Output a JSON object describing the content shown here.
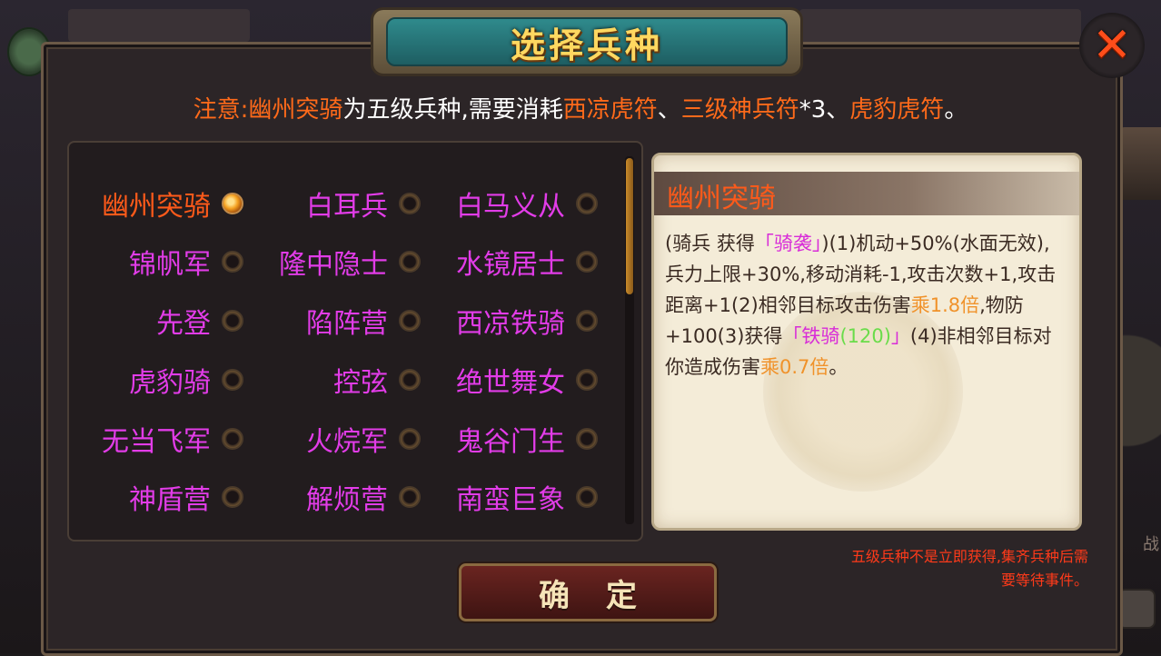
{
  "title": "选择兵种",
  "close_icon": "close-x-icon",
  "notice": {
    "prefix": "注意:",
    "unit": "幽州突骑",
    "mid": "为五级兵种,需要消耗",
    "item1": "西凉虎符",
    "sep": "、",
    "item2": "三级神兵符",
    "qty": "*3、",
    "item3": "虎豹虎符",
    "end": "。"
  },
  "units": [
    {
      "label": "幽州突骑",
      "selected": true
    },
    {
      "label": "白耳兵",
      "selected": false
    },
    {
      "label": "白马义从",
      "selected": false
    },
    {
      "label": "锦帆军",
      "selected": false
    },
    {
      "label": "隆中隐士",
      "selected": false
    },
    {
      "label": "水镜居士",
      "selected": false
    },
    {
      "label": "先登",
      "selected": false
    },
    {
      "label": "陷阵营",
      "selected": false
    },
    {
      "label": "西凉铁骑",
      "selected": false
    },
    {
      "label": "虎豹骑",
      "selected": false
    },
    {
      "label": "控弦",
      "selected": false
    },
    {
      "label": "绝世舞女",
      "selected": false
    },
    {
      "label": "无当飞军",
      "selected": false
    },
    {
      "label": "火烷军",
      "selected": false
    },
    {
      "label": "鬼谷门生",
      "selected": false
    },
    {
      "label": "神盾营",
      "selected": false
    },
    {
      "label": "解烦营",
      "selected": false
    },
    {
      "label": "南蛮巨象",
      "selected": false
    }
  ],
  "detail": {
    "title": "幽州突骑",
    "t1": "(骑兵 获得",
    "t2": "「骑袭」",
    "t3": ")(1)机动+50%(水面无效),兵力上限+30%,移动消耗-1,攻击次数+1,攻击距离+1(2)相邻目标攻击伤害",
    "t4": "乘1.8倍",
    "t5": ",物防+100(3)获得",
    "t6": "「铁骑",
    "t7": "(120)",
    "t8": "」",
    "t9": "(4)非相邻目标对你造成伤害",
    "t10": "乘0.7倍",
    "t11": "。"
  },
  "foot_note": {
    "line1": "五级兵种不是立即获得,集齐兵种后需",
    "line2": "要等待事件。"
  },
  "confirm_label": "确定",
  "background_text": "战",
  "colors": {
    "accent": "#ff5a1a",
    "unit_name": "#e23ce8",
    "title_gold": "#ffd860"
  }
}
